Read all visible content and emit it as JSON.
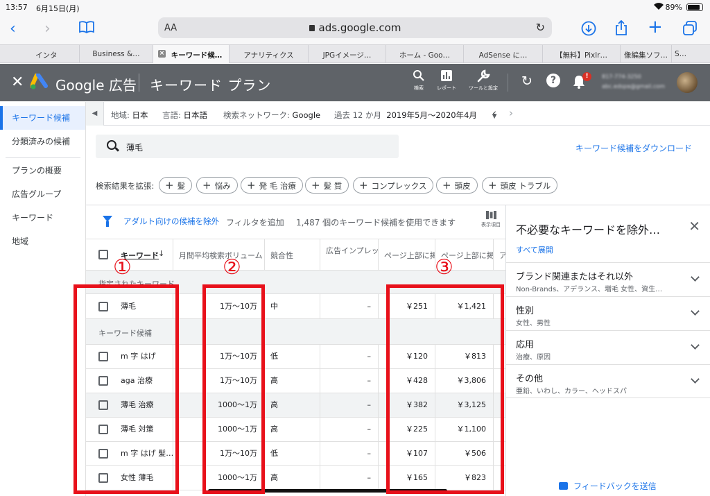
{
  "status_bar": {
    "time": "13:57",
    "date": "6月15日(月)",
    "battery": "89%"
  },
  "browser": {
    "aa": "AA",
    "url": "ads.google.com",
    "tabs": [
      {
        "label": "インタ",
        "active": false
      },
      {
        "label": "Business &…",
        "active": false
      },
      {
        "label": "キーワード候…",
        "active": true
      },
      {
        "label": "アナリティクス",
        "active": false
      },
      {
        "label": "JPGイメージ…",
        "active": false
      },
      {
        "label": "ホーム - Goo…",
        "active": false
      },
      {
        "label": "AdSense に…",
        "active": false
      },
      {
        "label": "【無料】Pixlr…",
        "active": false
      },
      {
        "label": "像編集ソフ…",
        "active": false
      },
      {
        "label": "S…",
        "active": false
      }
    ]
  },
  "header": {
    "brand": "Google 広告",
    "page_title": "キーワード プラン",
    "icons": [
      {
        "name": "search-icon",
        "label": "検索"
      },
      {
        "name": "report-icon",
        "label": "レポート"
      },
      {
        "name": "tools-icon",
        "label": "ツールと設定"
      }
    ],
    "notifications": "!"
  },
  "sidebar": {
    "items": [
      {
        "label": "キーワード候補",
        "active": true
      },
      {
        "label": "分類済みの候補",
        "active": false
      },
      {
        "label": "プランの概要",
        "active": false
      },
      {
        "label": "広告グループ",
        "active": false
      },
      {
        "label": "キーワード",
        "active": false
      },
      {
        "label": "地域",
        "active": false
      }
    ]
  },
  "filters": {
    "location_label": "地域:",
    "location": "日本",
    "language_label": "言語:",
    "language": "日本語",
    "network_label": "検索ネットワーク:",
    "network": "Google",
    "period_label": "過去 12 か月",
    "period": "2019年5月～2020年4月"
  },
  "search": {
    "value": "薄毛",
    "download": "キーワード候補をダウンロード"
  },
  "expand": {
    "label": "検索結果を拡張:",
    "chips": [
      "髪",
      "悩み",
      "発 毛 治療",
      "髪 質",
      "コンプレックス",
      "頭皮",
      "頭皮 トラブル"
    ]
  },
  "table_bar": {
    "adult_filter": "アダルト向けの候補を除外",
    "add_filter": "フィルタを追加",
    "count_text": "1,487 個のキーワード候補を使用できます",
    "columns_label": "表示項目"
  },
  "table": {
    "headers": [
      "キーワード",
      "月間平均検索ボリューム",
      "競合性",
      "広告インプレッ",
      "ページ上部に掲",
      "ページ上部に掲",
      "ア"
    ],
    "group_specified": "指定されたキーワード",
    "group_ideas": "キーワード候補",
    "specified": {
      "keyword": "薄毛",
      "volume": "1万～10万",
      "competition": "中",
      "impr": "–",
      "low_bid": "￥251",
      "high_bid": "￥1,421"
    },
    "rows": [
      {
        "keyword": "m 字 はげ",
        "volume": "1万～10万",
        "competition": "低",
        "impr": "–",
        "low_bid": "￥120",
        "high_bid": "￥813",
        "hl": false
      },
      {
        "keyword": "aga 治療",
        "volume": "1万～10万",
        "competition": "高",
        "impr": "–",
        "low_bid": "￥428",
        "high_bid": "￥3,806",
        "hl": false
      },
      {
        "keyword": "薄毛 治療",
        "volume": "1000～1万",
        "competition": "高",
        "impr": "–",
        "low_bid": "￥382",
        "high_bid": "￥3,125",
        "hl": true
      },
      {
        "keyword": "薄毛 対策",
        "volume": "1000～1万",
        "competition": "高",
        "impr": "–",
        "low_bid": "￥225",
        "high_bid": "￥1,100",
        "hl": false
      },
      {
        "keyword": "m 字 はげ 髪…",
        "volume": "1万～10万",
        "competition": "低",
        "impr": "–",
        "low_bid": "￥107",
        "high_bid": "￥506",
        "hl": false
      },
      {
        "keyword": "女性 薄毛",
        "volume": "1000～1万",
        "competition": "高",
        "impr": "–",
        "low_bid": "￥165",
        "high_bid": "￥823",
        "hl": false
      }
    ]
  },
  "right_panel": {
    "title": "不必要なキーワードを除外…",
    "expand_all": "すべて展開",
    "groups": [
      {
        "name": "ブランド関連またはそれ以外",
        "sub": "Non-Brands、アデランス、増毛 女性、資生…"
      },
      {
        "name": "性別",
        "sub": "女性、男性"
      },
      {
        "name": "応用",
        "sub": "治療、原因"
      },
      {
        "name": "その他",
        "sub": "亜鉛、いわし、カラー、ヘッドスパ"
      }
    ],
    "feedback": "フィードバックを送信"
  },
  "annotations": {
    "numbers": [
      "①",
      "②",
      "③"
    ],
    "color": "#e8101a"
  }
}
